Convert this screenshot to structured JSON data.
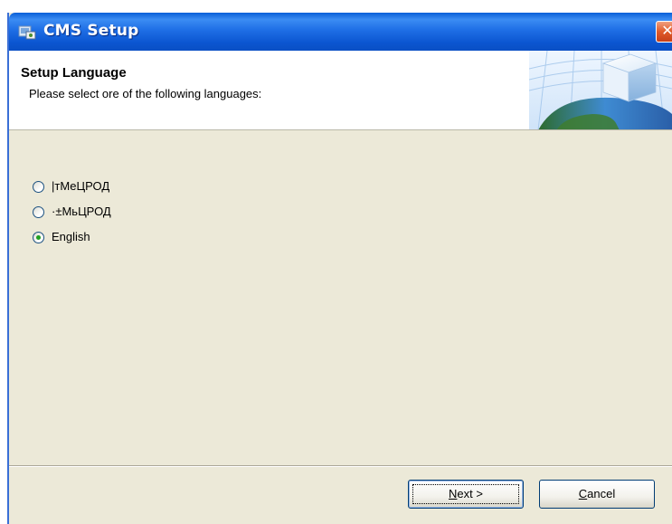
{
  "window": {
    "title": "CMS Setup",
    "close_glyph": "✕"
  },
  "header": {
    "title": "Setup Language",
    "subtitle": "Please select ore of the following languages:"
  },
  "languages": [
    {
      "label": "|тМеЦРОД",
      "selected": false
    },
    {
      "label": "·±МьЦРОД",
      "selected": false
    },
    {
      "label": "English",
      "selected": true
    }
  ],
  "buttons": {
    "next": {
      "hotkey": "N",
      "rest": "ext >"
    },
    "cancel": {
      "hotkey": "C",
      "rest": "ancel"
    }
  },
  "colors": {
    "titlebar": "#0b55d0",
    "panel": "#ece9d8",
    "radio_dot": "#21a121",
    "close": "#e05a2a"
  },
  "icons": [
    "setup-app-icon",
    "close-icon",
    "header-globe-cube-graphic",
    "radio-button-icon"
  ]
}
